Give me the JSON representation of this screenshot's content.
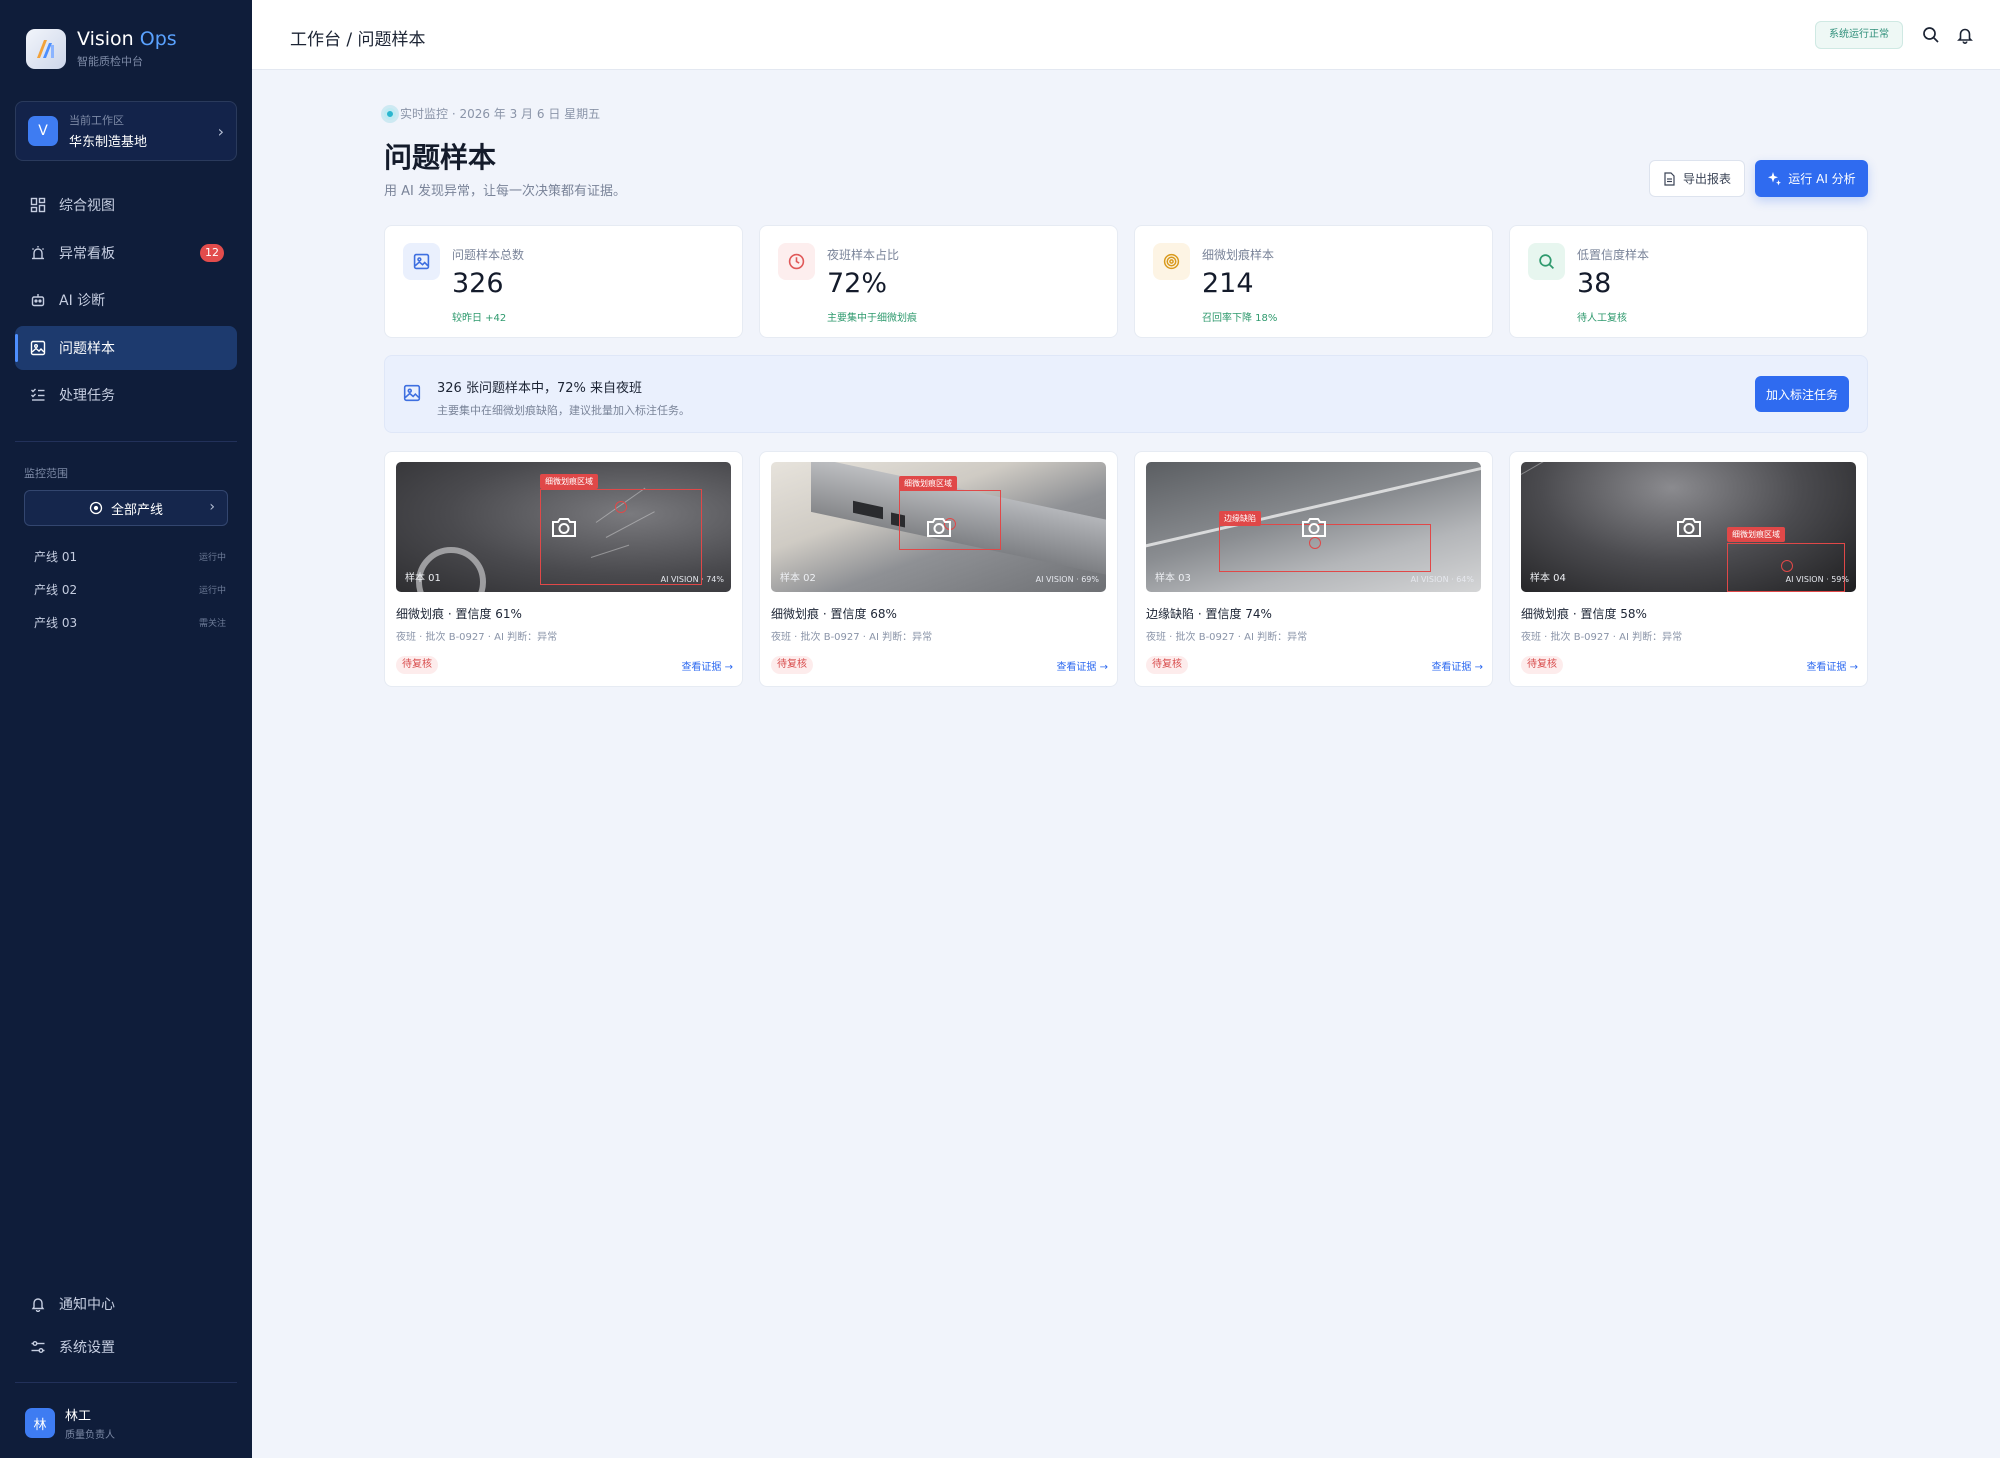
{
  "brand": {
    "name_prefix": "Vision",
    "name_accent": "Ops",
    "subtitle": "智能质检中台"
  },
  "workspace": {
    "badge": "V",
    "label": "当前工作区",
    "name": "华东制造基地",
    "chevron": "›"
  },
  "nav": {
    "items": [
      {
        "label": "综合视图",
        "icon": "grid-icon"
      },
      {
        "label": "异常看板",
        "icon": "alarm-icon",
        "badge": "12"
      },
      {
        "label": "AI 诊断",
        "icon": "robot-icon"
      },
      {
        "label": "问题样本",
        "icon": "image-icon",
        "active": true
      },
      {
        "label": "处理任务",
        "icon": "checklist-icon"
      }
    ]
  },
  "monitor": {
    "section_label": "监控范围",
    "selector_label": "全部产线",
    "selector_chevron": "›",
    "lines": [
      {
        "name": "产线 01",
        "status": "运行中"
      },
      {
        "name": "产线 02",
        "status": "运行中"
      },
      {
        "name": "产线 03",
        "status": "需关注"
      }
    ]
  },
  "nav_bottom": {
    "items": [
      {
        "label": "通知中心",
        "icon": "bell-icon"
      },
      {
        "label": "系统设置",
        "icon": "sliders-icon"
      }
    ]
  },
  "user": {
    "avatar": "林",
    "name": "林工",
    "role": "质量负责人"
  },
  "topbar": {
    "breadcrumb": "工作台 / 问题样本",
    "status": "系统运行正常"
  },
  "header": {
    "live": "实时监控 · 2026 年 3 月 6 日 星期五",
    "title": "问题样本",
    "subtitle": "用 AI 发现异常，让每一次决策都有证据。",
    "export_label": "导出报表",
    "ai_label": "运行 AI 分析"
  },
  "stats": [
    {
      "label": "问题样本总数",
      "value": "326",
      "note": "较昨日 +42",
      "icon": "image-icon",
      "color": "#3e6fe0",
      "bg": "#eaf0fd"
    },
    {
      "label": "夜班样本占比",
      "value": "72%",
      "note": "主要集中于细微划痕",
      "icon": "clock-icon",
      "color": "#e05858",
      "bg": "#fdeeee"
    },
    {
      "label": "细微划痕样本",
      "value": "214",
      "note": "召回率下降 18%",
      "icon": "target-icon",
      "color": "#d99a1d",
      "bg": "#fdf4e4"
    },
    {
      "label": "低置信度样本",
      "value": "38",
      "note": "待人工复核",
      "icon": "search-icon",
      "color": "#2f9a6e",
      "bg": "#e7f6ef"
    }
  ],
  "insight": {
    "title": "326 张问题样本中，72% 来自夜班",
    "desc": "主要集中在细微划痕缺陷，建议批量加入标注任务。",
    "button": "加入标注任务"
  },
  "samples": [
    {
      "label": "样本 01",
      "tag": "细微划痕区域",
      "ai": "AI VISION · 74%",
      "title": "细微划痕 · 置信度 61%",
      "meta": "夜班 · 批次 B-0927 · AI 判断：异常",
      "status": "待复核",
      "link": "查看证据 →"
    },
    {
      "label": "样本 02",
      "tag": "细微划痕区域",
      "ai": "AI VISION · 69%",
      "title": "细微划痕 · 置信度 68%",
      "meta": "夜班 · 批次 B-0927 · AI 判断：异常",
      "status": "待复核",
      "link": "查看证据 →"
    },
    {
      "label": "样本 03",
      "tag": "边缘缺陷",
      "ai": "AI VISION · 64%",
      "title": "边缘缺陷 · 置信度 74%",
      "meta": "夜班 · 批次 B-0927 · AI 判断：异常",
      "status": "待复核",
      "link": "查看证据 →"
    },
    {
      "label": "样本 04",
      "tag": "细微划痕区域",
      "ai": "AI VISION · 59%",
      "title": "细微划痕 · 置信度 58%",
      "meta": "夜班 · 批次 B-0927 · AI 判断：异常",
      "status": "待复核",
      "link": "查看证据 →"
    }
  ]
}
